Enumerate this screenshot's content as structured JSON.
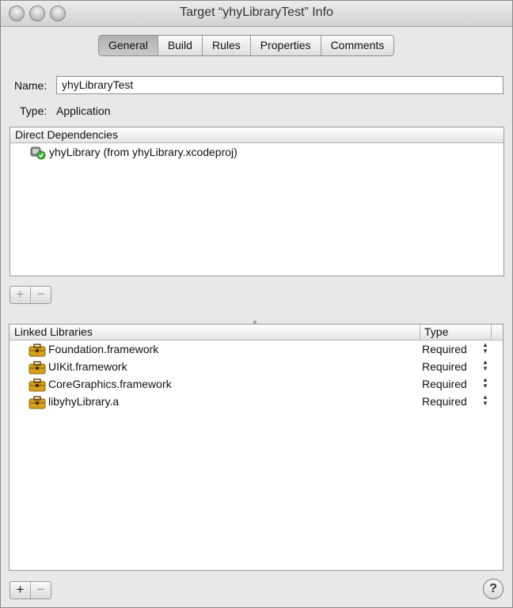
{
  "window": {
    "title": "Target “yhyLibraryTest” Info"
  },
  "tabs": [
    {
      "label": "General",
      "active": true
    },
    {
      "label": "Build",
      "active": false
    },
    {
      "label": "Rules",
      "active": false
    },
    {
      "label": "Properties",
      "active": false
    },
    {
      "label": "Comments",
      "active": false
    }
  ],
  "general": {
    "name_label": "Name:",
    "name_value": "yhyLibraryTest",
    "type_label": "Type:",
    "type_value": "Application"
  },
  "dependencies": {
    "header": "Direct Dependencies",
    "items": [
      {
        "label": "yhyLibrary (from yhyLibrary.xcodeproj)",
        "icon": "target-dependency-icon"
      }
    ],
    "add_label": "+",
    "remove_label": "−"
  },
  "libraries": {
    "col_name": "Linked Libraries",
    "col_type": "Type",
    "items": [
      {
        "name": "Foundation.framework",
        "type": "Required",
        "icon": "framework-toolbox-icon"
      },
      {
        "name": "UIKit.framework",
        "type": "Required",
        "icon": "framework-toolbox-icon"
      },
      {
        "name": "CoreGraphics.framework",
        "type": "Required",
        "icon": "framework-toolbox-icon"
      },
      {
        "name": "libyhyLibrary.a",
        "type": "Required",
        "icon": "framework-toolbox-icon"
      }
    ],
    "add_label": "+",
    "remove_label": "−"
  },
  "help_label": "?",
  "stepper_glyphs": {
    "up": "▲",
    "down": "▼"
  },
  "colors": {
    "panel_bg": "#ffffff",
    "window_bg": "#e8e8e8",
    "active_tab": "#bdbdbd"
  }
}
